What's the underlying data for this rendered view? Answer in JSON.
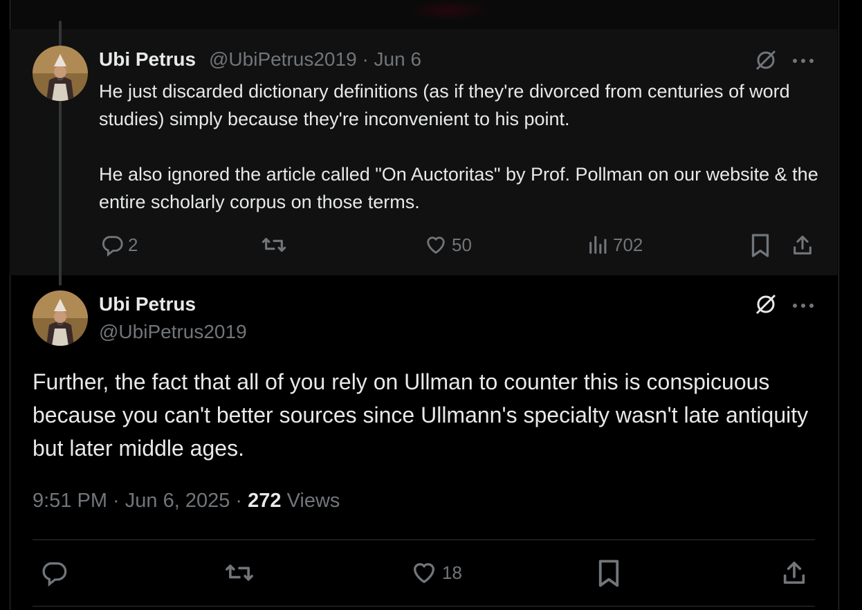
{
  "reply": {
    "display_name": "Ubi Petrus",
    "handle": "@UbiPetrus2019",
    "separator": "·",
    "date": "Jun 6",
    "paragraphs": [
      "He just discarded dictionary definitions (as if they're divorced from centuries of word studies) simply because they're inconvenient to his point.",
      "He also ignored the article called \"On Auctoritas\" by Prof.  Pollman on our website & the entire scholarly corpus on those terms."
    ],
    "replies": "2",
    "likes": "50",
    "views": "702"
  },
  "main": {
    "display_name": "Ubi Petrus",
    "handle": "@UbiPetrus2019",
    "text": "Further, the fact that all of you rely on Ullman to counter this is conspicuous because you can't  better sources since Ullmann's specialty wasn't late antiquity but later middle ages.",
    "time": "9:51 PM · Jun 6, 2025 · ",
    "views_count": "272",
    "views_label": " Views",
    "likes": "18"
  },
  "icons": {
    "more": "more-icon",
    "grok": "grok-icon",
    "reply": "reply-icon",
    "repost": "repost-icon",
    "like": "like-icon",
    "views": "views-icon",
    "bookmark": "bookmark-icon",
    "share": "share-icon"
  },
  "colors": {
    "background": "#000000",
    "card": "#111111",
    "text": "#e7e9ea",
    "muted": "#71767b",
    "border": "#2f3336"
  }
}
